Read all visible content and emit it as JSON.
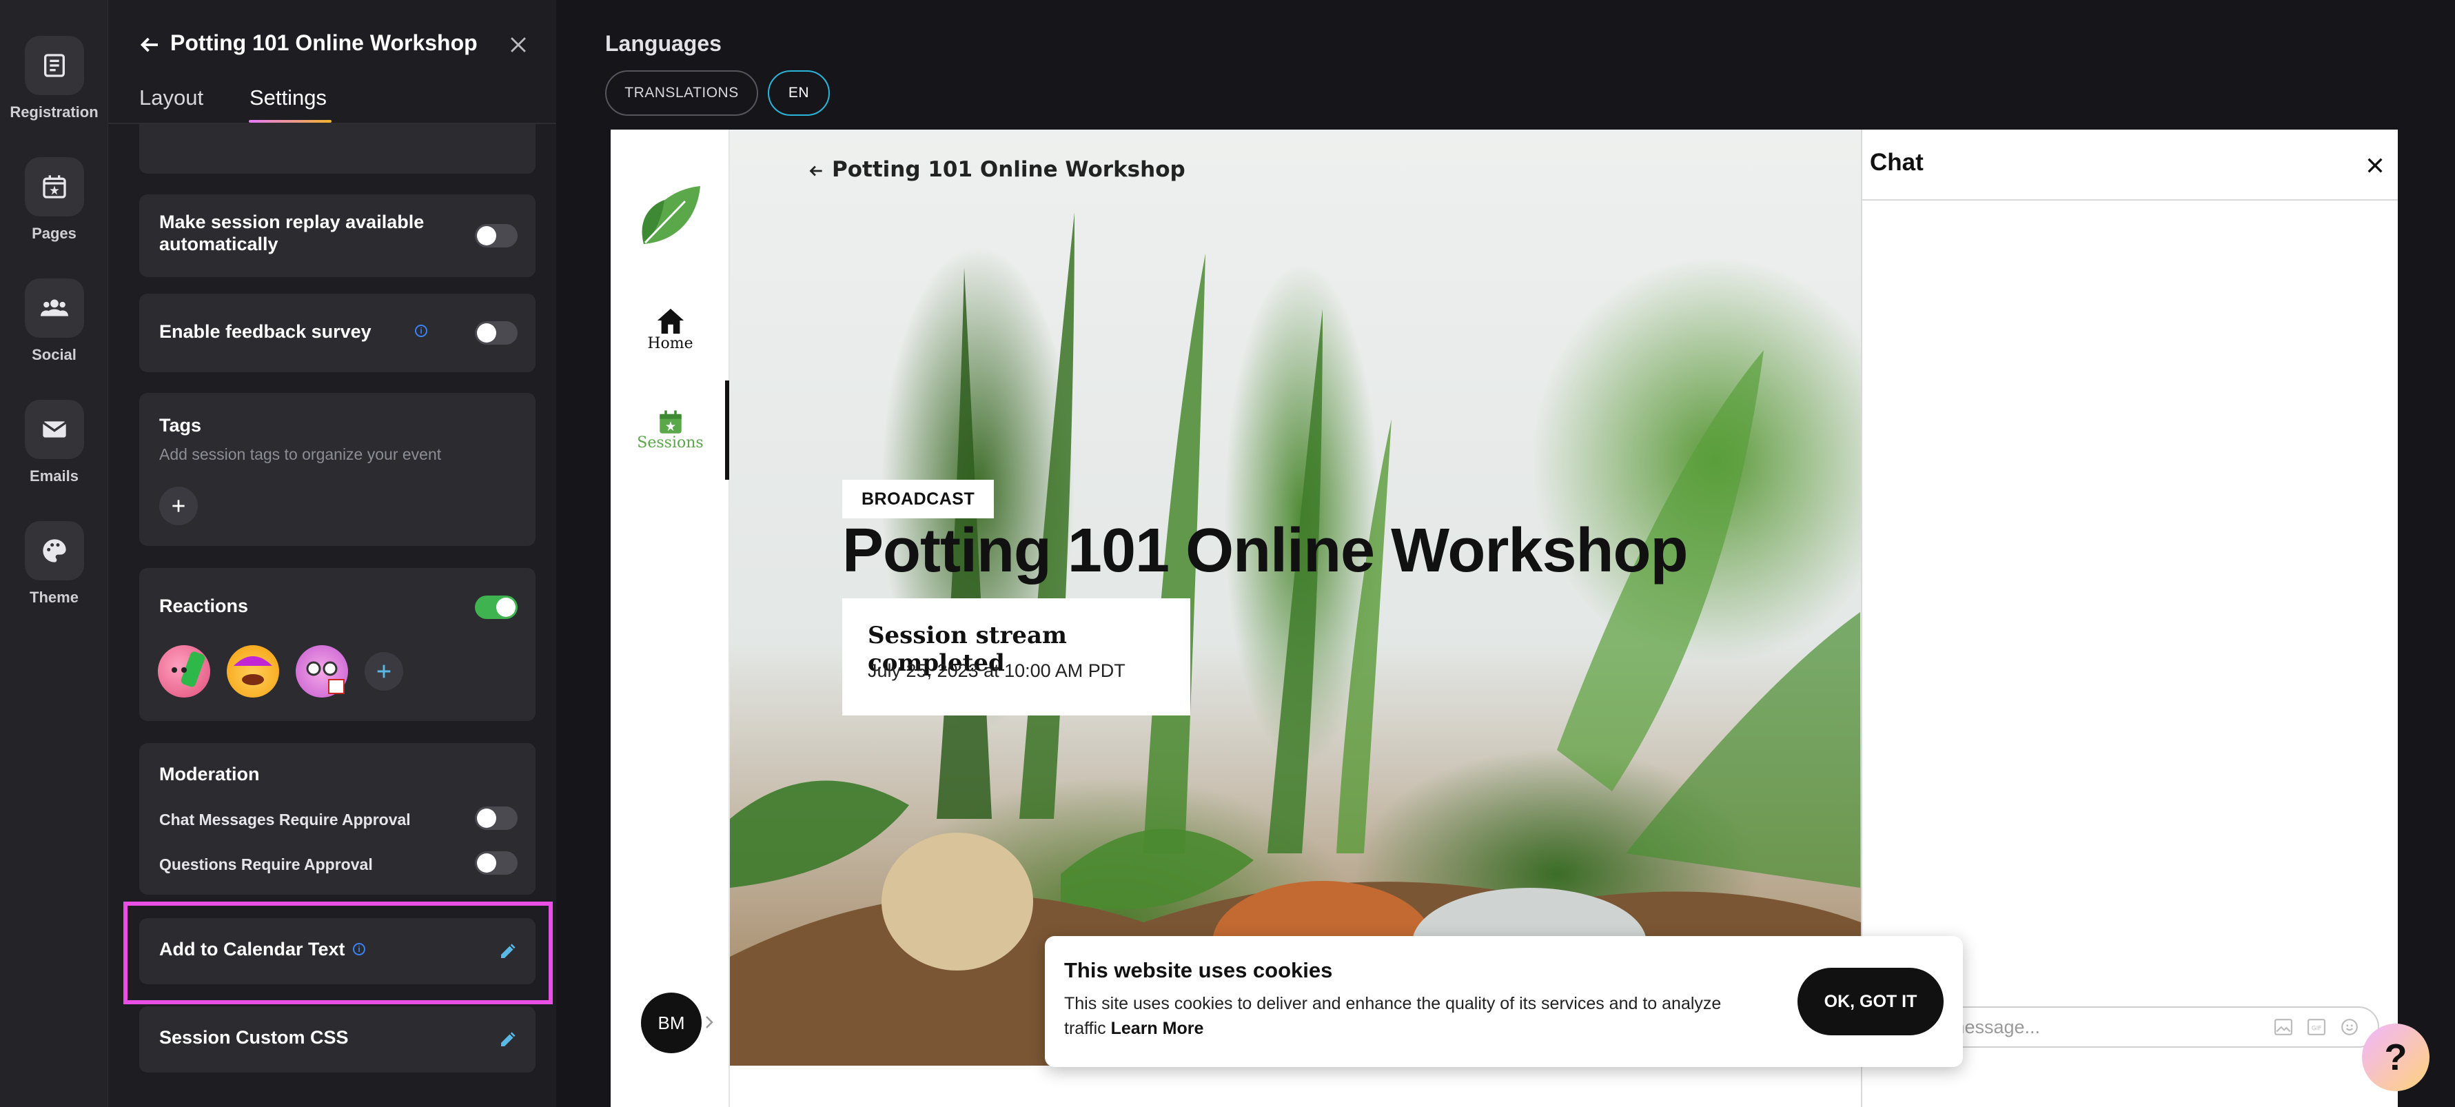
{
  "rail": {
    "items": [
      {
        "label": "Registration",
        "icon": "registration-icon"
      },
      {
        "label": "Pages",
        "icon": "pages-icon"
      },
      {
        "label": "Social",
        "icon": "social-icon"
      },
      {
        "label": "Emails",
        "icon": "emails-icon"
      },
      {
        "label": "Theme",
        "icon": "theme-icon"
      }
    ]
  },
  "panel": {
    "title": "Potting 101 Online Workshop",
    "tabs": [
      "Layout",
      "Settings"
    ],
    "active_tab": "Settings",
    "settings": {
      "replay_label": "Make session replay available automatically",
      "replay_on": false,
      "feedback_label": "Enable feedback survey",
      "feedback_on": false,
      "tags_title": "Tags",
      "tags_sub": "Add session tags to organize your event",
      "reactions_title": "Reactions",
      "reactions_on": true,
      "moderation_title": "Moderation",
      "chat_approval_label": "Chat Messages Require Approval",
      "chat_approval_on": false,
      "questions_approval_label": "Questions Require Approval",
      "questions_approval_on": false,
      "calendar_label": "Add to Calendar Text",
      "css_label": "Session Custom CSS"
    }
  },
  "main": {
    "languages_title": "Languages",
    "pills": [
      "TRANSLATIONS",
      "EN"
    ],
    "active_pill": "EN"
  },
  "preview": {
    "nav": [
      {
        "label": "Home",
        "icon": "home-icon"
      },
      {
        "label": "Sessions",
        "icon": "calendar-icon"
      }
    ],
    "back_title": "Potting 101 Online Workshop",
    "badge": "BROADCAST",
    "hero_title": "Potting 101 Online Workshop",
    "status_title": "Session stream completed",
    "status_date": "July 25, 2023 at 10:00 AM PDT",
    "chat_title": "Chat",
    "chat_placeholder": "message...",
    "avatar_initials": "BM"
  },
  "cookie": {
    "title": "This website uses cookies",
    "text": "This site uses cookies to deliver and enhance the quality of its services and to analyze traffic",
    "link": "Learn More",
    "button": "OK, GOT IT"
  },
  "help": {
    "label": "?"
  },
  "colors": {
    "accent_toggle_on": "#3fb34f",
    "highlight": "#e94fe4",
    "pill_active": "#2bb5d8",
    "brand_green": "#5aa84a"
  }
}
